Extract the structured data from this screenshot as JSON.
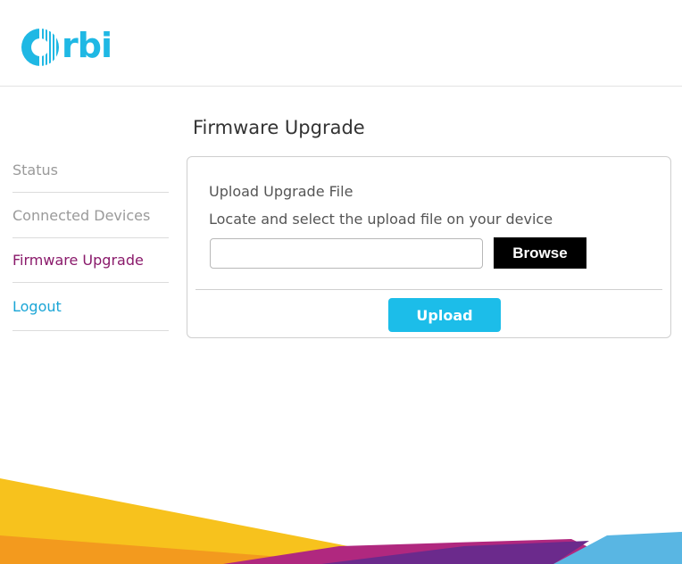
{
  "header": {
    "logo_text": "rbi"
  },
  "page": {
    "title": "Firmware Upgrade"
  },
  "sidebar": {
    "items": [
      {
        "label": "Status"
      },
      {
        "label": "Connected Devices"
      },
      {
        "label": "Firmware Upgrade",
        "active": true
      },
      {
        "label": "Logout"
      }
    ]
  },
  "upload_panel": {
    "title": "Upload Upgrade File",
    "description": "Locate and select the upload file on your device",
    "file_value": "",
    "browse_label": "Browse",
    "upload_label": "Upload"
  },
  "colors": {
    "brand_blue": "#1fb8e4",
    "active_nav": "#8a1a6b",
    "logout": "#1aa5d6",
    "upload_button": "#1cbde9",
    "browse_button": "#000000",
    "footer_yellow": "#f7c21d",
    "footer_orange": "#f39a1e",
    "footer_purple": "#6b2a8c",
    "footer_magenta": "#b0287f",
    "footer_blue": "#59b6e3"
  }
}
